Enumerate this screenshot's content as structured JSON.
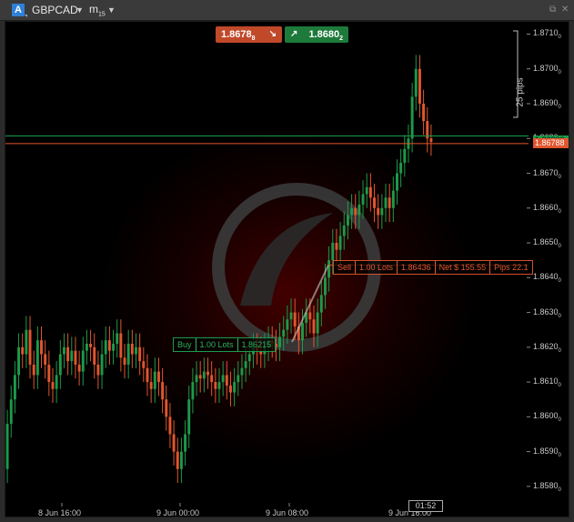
{
  "toolbar": {
    "account_badge": "A",
    "symbol": "GBPCAD",
    "symbol_arrow": "▼",
    "timeframe_main": "m",
    "timeframe_sub": "15",
    "timeframe_arrow": "▼",
    "icon_detach": "⧉",
    "icon_close": "✕"
  },
  "trade_buttons": {
    "sell_price_main": "1.8678",
    "sell_price_sub": "8",
    "sell_icon": "↘",
    "buy_price_main": "1.8680",
    "buy_price_sub": "2",
    "buy_icon": "↗"
  },
  "price_axis": {
    "labels": [
      "1.8710",
      "1.8700",
      "1.8690",
      "1.8680",
      "1.8670",
      "1.8660",
      "1.8650",
      "1.8640",
      "1.8630",
      "1.8620",
      "1.8610",
      "1.8600",
      "1.8590",
      "1.8580"
    ],
    "suffix": "0",
    "ask_tag": "1.86802",
    "bid_tag": "1.86788"
  },
  "time_axis": {
    "labels": [
      "8 Jun 16:00",
      "9 Jun 00:00",
      "9 Jun 08:00",
      "9 Jun 16:00"
    ]
  },
  "ruler": {
    "label": "25 pips"
  },
  "positions": {
    "sell": {
      "side": "Sell",
      "lots": "1.00 Lots",
      "price": "1.86436",
      "net": "Net $ 155.55",
      "pips": "Pips 22.1"
    },
    "buy": {
      "side": "Buy",
      "lots": "1.00 Lots",
      "price": "1.86215"
    }
  },
  "clock": "01:52",
  "colors": {
    "bull": "#1d9a4a",
    "bear": "#e2562e",
    "bg": "#000000",
    "ask_line": "#1d9a4a",
    "bid_line": "#e2562e"
  },
  "chart_data": {
    "type": "candlestick",
    "symbol": "GBPCAD",
    "timeframe": "m15",
    "ylim": [
      1.8575,
      1.8713
    ],
    "ask": 1.86802,
    "bid": 1.86788,
    "series": [
      {
        "name": "o",
        "values": [
          1.8585,
          1.8598,
          1.8605,
          1.8612,
          1.862,
          1.8618,
          1.8625,
          1.8615,
          1.8612,
          1.8622,
          1.8618,
          1.8615,
          1.861,
          1.8608,
          1.8612,
          1.8618,
          1.862,
          1.8616,
          1.8619,
          1.8615,
          1.8613,
          1.8619,
          1.8621,
          1.862,
          1.8615,
          1.8612,
          1.8618,
          1.8622,
          1.8619,
          1.8621,
          1.8624,
          1.8617,
          1.8615,
          1.8621,
          1.8618,
          1.862,
          1.8616,
          1.8614,
          1.861,
          1.8608,
          1.8613,
          1.861,
          1.8605,
          1.86,
          1.8595,
          1.859,
          1.8585,
          1.859,
          1.8595,
          1.8605,
          1.861,
          1.8612,
          1.8611,
          1.8613,
          1.8612,
          1.861,
          1.8608,
          1.861,
          1.8612,
          1.8609,
          1.8607,
          1.861,
          1.8612,
          1.8614,
          1.8616,
          1.8618,
          1.862,
          1.8619,
          1.8618,
          1.862,
          1.8622,
          1.8621,
          1.862,
          1.8623,
          1.8625,
          1.8628,
          1.863,
          1.8626,
          1.8622,
          1.8627,
          1.863,
          1.8628,
          1.8624,
          1.863,
          1.8635,
          1.864,
          1.8645,
          1.865,
          1.8648,
          1.8652,
          1.8655,
          1.8658,
          1.866,
          1.8658,
          1.8661,
          1.8664,
          1.8666,
          1.8663,
          1.866,
          1.8658,
          1.866,
          1.8663,
          1.866,
          1.8665,
          1.867,
          1.8673,
          1.8677,
          1.868,
          1.8692,
          1.87,
          1.869,
          1.8685,
          1.868
        ]
      },
      {
        "name": "c",
        "values": [
          1.8598,
          1.8605,
          1.8612,
          1.862,
          1.8618,
          1.8625,
          1.8615,
          1.8612,
          1.8622,
          1.8618,
          1.8615,
          1.861,
          1.8608,
          1.8612,
          1.8618,
          1.862,
          1.8616,
          1.8619,
          1.8615,
          1.8613,
          1.8619,
          1.8621,
          1.862,
          1.8615,
          1.8612,
          1.8618,
          1.8622,
          1.8619,
          1.8621,
          1.8624,
          1.8617,
          1.8615,
          1.8621,
          1.8618,
          1.862,
          1.8616,
          1.8614,
          1.861,
          1.8608,
          1.8613,
          1.861,
          1.8605,
          1.86,
          1.8595,
          1.859,
          1.8585,
          1.859,
          1.8595,
          1.8605,
          1.861,
          1.8612,
          1.8611,
          1.8613,
          1.8612,
          1.861,
          1.8608,
          1.861,
          1.8612,
          1.8609,
          1.8607,
          1.861,
          1.8612,
          1.8614,
          1.8616,
          1.8618,
          1.862,
          1.8619,
          1.8618,
          1.862,
          1.8622,
          1.8621,
          1.862,
          1.8623,
          1.8625,
          1.8628,
          1.863,
          1.8626,
          1.8622,
          1.8627,
          1.863,
          1.8628,
          1.8624,
          1.863,
          1.8635,
          1.864,
          1.8645,
          1.865,
          1.8648,
          1.8652,
          1.8655,
          1.8658,
          1.866,
          1.8658,
          1.8661,
          1.8664,
          1.8666,
          1.8663,
          1.866,
          1.8658,
          1.866,
          1.8663,
          1.866,
          1.8665,
          1.867,
          1.8673,
          1.8677,
          1.868,
          1.8692,
          1.87,
          1.869,
          1.8685,
          1.868,
          1.8679
        ]
      }
    ]
  }
}
